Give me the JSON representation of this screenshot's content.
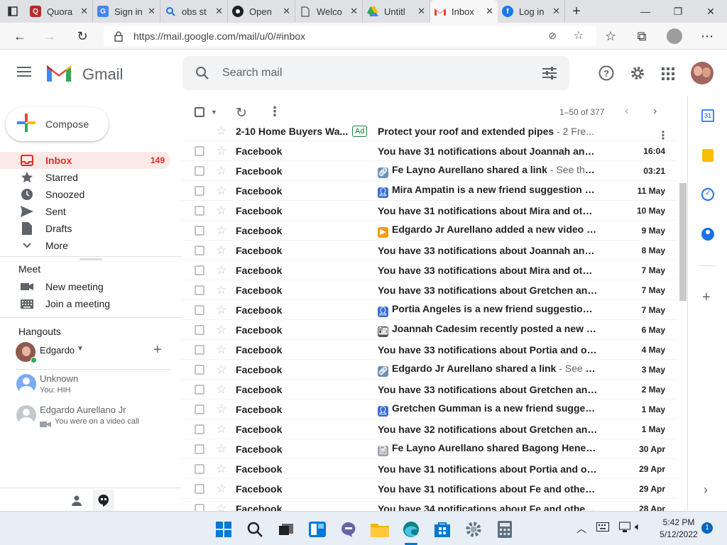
{
  "browser": {
    "tabs": [
      {
        "title": "Quora",
        "favicon": "Q",
        "color": "#b92b27"
      },
      {
        "title": "Sign in",
        "favicon": "G",
        "color": "#4285f4"
      },
      {
        "title": "obs st",
        "favicon": "search",
        "color": "#1a73e8"
      },
      {
        "title": "Open",
        "favicon": "obs",
        "color": "#202124"
      },
      {
        "title": "Welco",
        "favicon": "doc",
        "color": "#555"
      },
      {
        "title": "Untitl",
        "favicon": "drive",
        "color": "#34a853"
      },
      {
        "title": "Inbox",
        "favicon": "M",
        "color": "#ea4335",
        "active": true
      },
      {
        "title": "Log in",
        "favicon": "f",
        "color": "#1877f2"
      }
    ],
    "url": "https://mail.google.com/mail/u/0/#inbox"
  },
  "gmail": {
    "logo_text": "Gmail",
    "search_placeholder": "Search mail",
    "compose_label": "Compose",
    "nav": [
      {
        "label": "Inbox",
        "count": "149",
        "icon": "inbox-icon",
        "active": true
      },
      {
        "label": "Starred",
        "count": "",
        "icon": "star-icon"
      },
      {
        "label": "Snoozed",
        "count": "",
        "icon": "clock-icon"
      },
      {
        "label": "Sent",
        "count": "",
        "icon": "send-icon"
      },
      {
        "label": "Drafts",
        "count": "",
        "icon": "draft-icon"
      },
      {
        "label": "More",
        "count": "",
        "icon": "chevron-down-icon"
      }
    ],
    "meet": {
      "title": "Meet",
      "new_meeting": "New meeting",
      "join_meeting": "Join a meeting"
    },
    "hangouts": {
      "title": "Hangouts",
      "user": "Edgardo",
      "contacts": [
        {
          "name": "Unknown",
          "status": "You: HIH"
        },
        {
          "name": "Edgardo Aurellano Jr",
          "status": "You were on a video call"
        }
      ]
    },
    "pagination": "1–50 of 377",
    "emails": [
      {
        "sender": "2-10 Home Buyers Wa...",
        "badge": "Ad",
        "subject": "Protect your roof and extended pipes",
        "snippet": " - 2 Fre...",
        "date": "",
        "emoji": ""
      },
      {
        "sender": "Facebook",
        "subject": "You have 31 notifications about Joannah and ...",
        "snippet": "",
        "date": "16:04",
        "emoji": ""
      },
      {
        "sender": "Facebook",
        "subject": "Fe Layno Aurellano shared a link",
        "snippet": " - See the ...",
        "date": "03:21",
        "emoji": "link"
      },
      {
        "sender": "Facebook",
        "subject": "Mira Ampatin is a new friend suggestion fo...",
        "snippet": "",
        "date": "11 May",
        "emoji": "person"
      },
      {
        "sender": "Facebook",
        "subject": "You have 31 notifications about Mira and othe...",
        "snippet": "",
        "date": "10 May",
        "emoji": ""
      },
      {
        "sender": "Facebook",
        "subject": "Edgardo Jr Aurellano added a new video",
        "snippet": " - ▶",
        "date": "9 May",
        "emoji": "video"
      },
      {
        "sender": "Facebook",
        "subject": "You have 33 notifications about Joannah and ...",
        "snippet": "",
        "date": "8 May",
        "emoji": ""
      },
      {
        "sender": "Facebook",
        "subject": "You have 33 notifications about Mira and othe...",
        "snippet": "",
        "date": "7 May",
        "emoji": ""
      },
      {
        "sender": "Facebook",
        "subject": "You have 33 notifications about Gretchen and ...",
        "snippet": "",
        "date": "7 May",
        "emoji": ""
      },
      {
        "sender": "Facebook",
        "subject": "Portia Angeles is a new friend suggestion f...",
        "snippet": "",
        "date": "7 May",
        "emoji": "person"
      },
      {
        "sender": "Facebook",
        "subject": "Joannah Cadesim recently posted a new p...",
        "snippet": "",
        "date": "6 May",
        "emoji": "camera"
      },
      {
        "sender": "Facebook",
        "subject": "You have 33 notifications about Portia and oth...",
        "snippet": "",
        "date": "4 May",
        "emoji": ""
      },
      {
        "sender": "Facebook",
        "subject": "Edgardo Jr Aurellano shared a link",
        "snippet": " - See th...",
        "date": "3 May",
        "emoji": "link"
      },
      {
        "sender": "Facebook",
        "subject": "You have 33 notifications about Gretchen and ...",
        "snippet": "",
        "date": "2 May",
        "emoji": ""
      },
      {
        "sender": "Facebook",
        "subject": "Gretchen Gumman is a new friend suggesti...",
        "snippet": "",
        "date": "1 May",
        "emoji": "person"
      },
      {
        "sender": "Facebook",
        "subject": "You have 32 notifications about Gretchen and ...",
        "snippet": "",
        "date": "1 May",
        "emoji": ""
      },
      {
        "sender": "Facebook",
        "subject": "Fe Layno Aurellano shared Bagong Henera...",
        "snippet": "",
        "date": "30 Apr",
        "emoji": "doc"
      },
      {
        "sender": "Facebook",
        "subject": "You have 31 notifications about Portia and oth...",
        "snippet": "",
        "date": "29 Apr",
        "emoji": ""
      },
      {
        "sender": "Facebook",
        "subject": "You have 31 notifications about Fe and others",
        "snippet": " - ...",
        "date": "29 Apr",
        "emoji": ""
      },
      {
        "sender": "Facebook",
        "subject": "You have 34 notifications about Fe and others",
        "snippet": " - ...",
        "date": "28 Apr",
        "emoji": ""
      }
    ]
  },
  "taskbar": {
    "time": "5:42 PM",
    "date": "5/12/2022",
    "notification_count": "1"
  },
  "colors": {
    "gmail_red": "#ea4335",
    "inbox_active_bg": "#fce8e6",
    "inbox_active_text": "#d93025"
  }
}
